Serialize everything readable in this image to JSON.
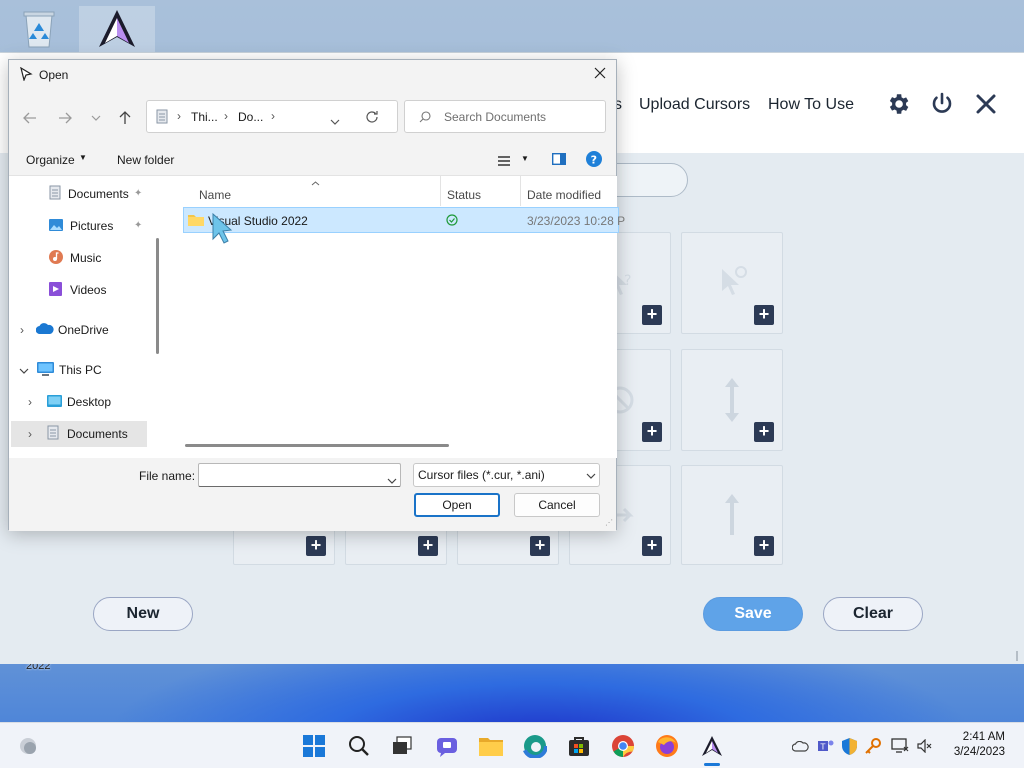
{
  "desktop": {
    "bottom_text": "2022"
  },
  "app": {
    "nav": {
      "upload_cursors": "Upload Cursors",
      "how_to_use": "How To Use",
      "partial": "s"
    },
    "buttons": {
      "new": "New",
      "save": "Save",
      "clear": "Clear"
    },
    "colors": {
      "save_bg": "#5fa3e8",
      "tile_plus": "#2c3a55"
    }
  },
  "dialog": {
    "title": "Open",
    "breadcrumb": [
      "Thi...",
      "Do..."
    ],
    "search_placeholder": "Search Documents",
    "toolbar": {
      "organize": "Organize",
      "new_folder": "New folder"
    },
    "sidebar": [
      {
        "label": "Documents",
        "icon": "documents-icon",
        "pinned": true
      },
      {
        "label": "Pictures",
        "icon": "pictures-icon",
        "pinned": true
      },
      {
        "label": "Music",
        "icon": "music-icon"
      },
      {
        "label": "Videos",
        "icon": "videos-icon"
      },
      {
        "label": "OneDrive",
        "icon": "onedrive-icon"
      },
      {
        "label": "This PC",
        "icon": "this-pc-icon"
      },
      {
        "label": "Desktop",
        "icon": "desktop-folder-icon"
      },
      {
        "label": "Documents",
        "icon": "documents-icon"
      }
    ],
    "columns": {
      "name": "Name",
      "status": "Status",
      "date_modified": "Date modified"
    },
    "files": [
      {
        "name": "Visual Studio 2022",
        "date_modified": "3/23/2023 10:28 P"
      }
    ],
    "file_name_label": "File name:",
    "file_name_value": "",
    "file_type": "Cursor files (*.cur, *.ani)",
    "open_button": "Open",
    "cancel_button": "Cancel"
  },
  "taskbar": {
    "time": "2:41 AM",
    "date": "3/24/2023"
  }
}
